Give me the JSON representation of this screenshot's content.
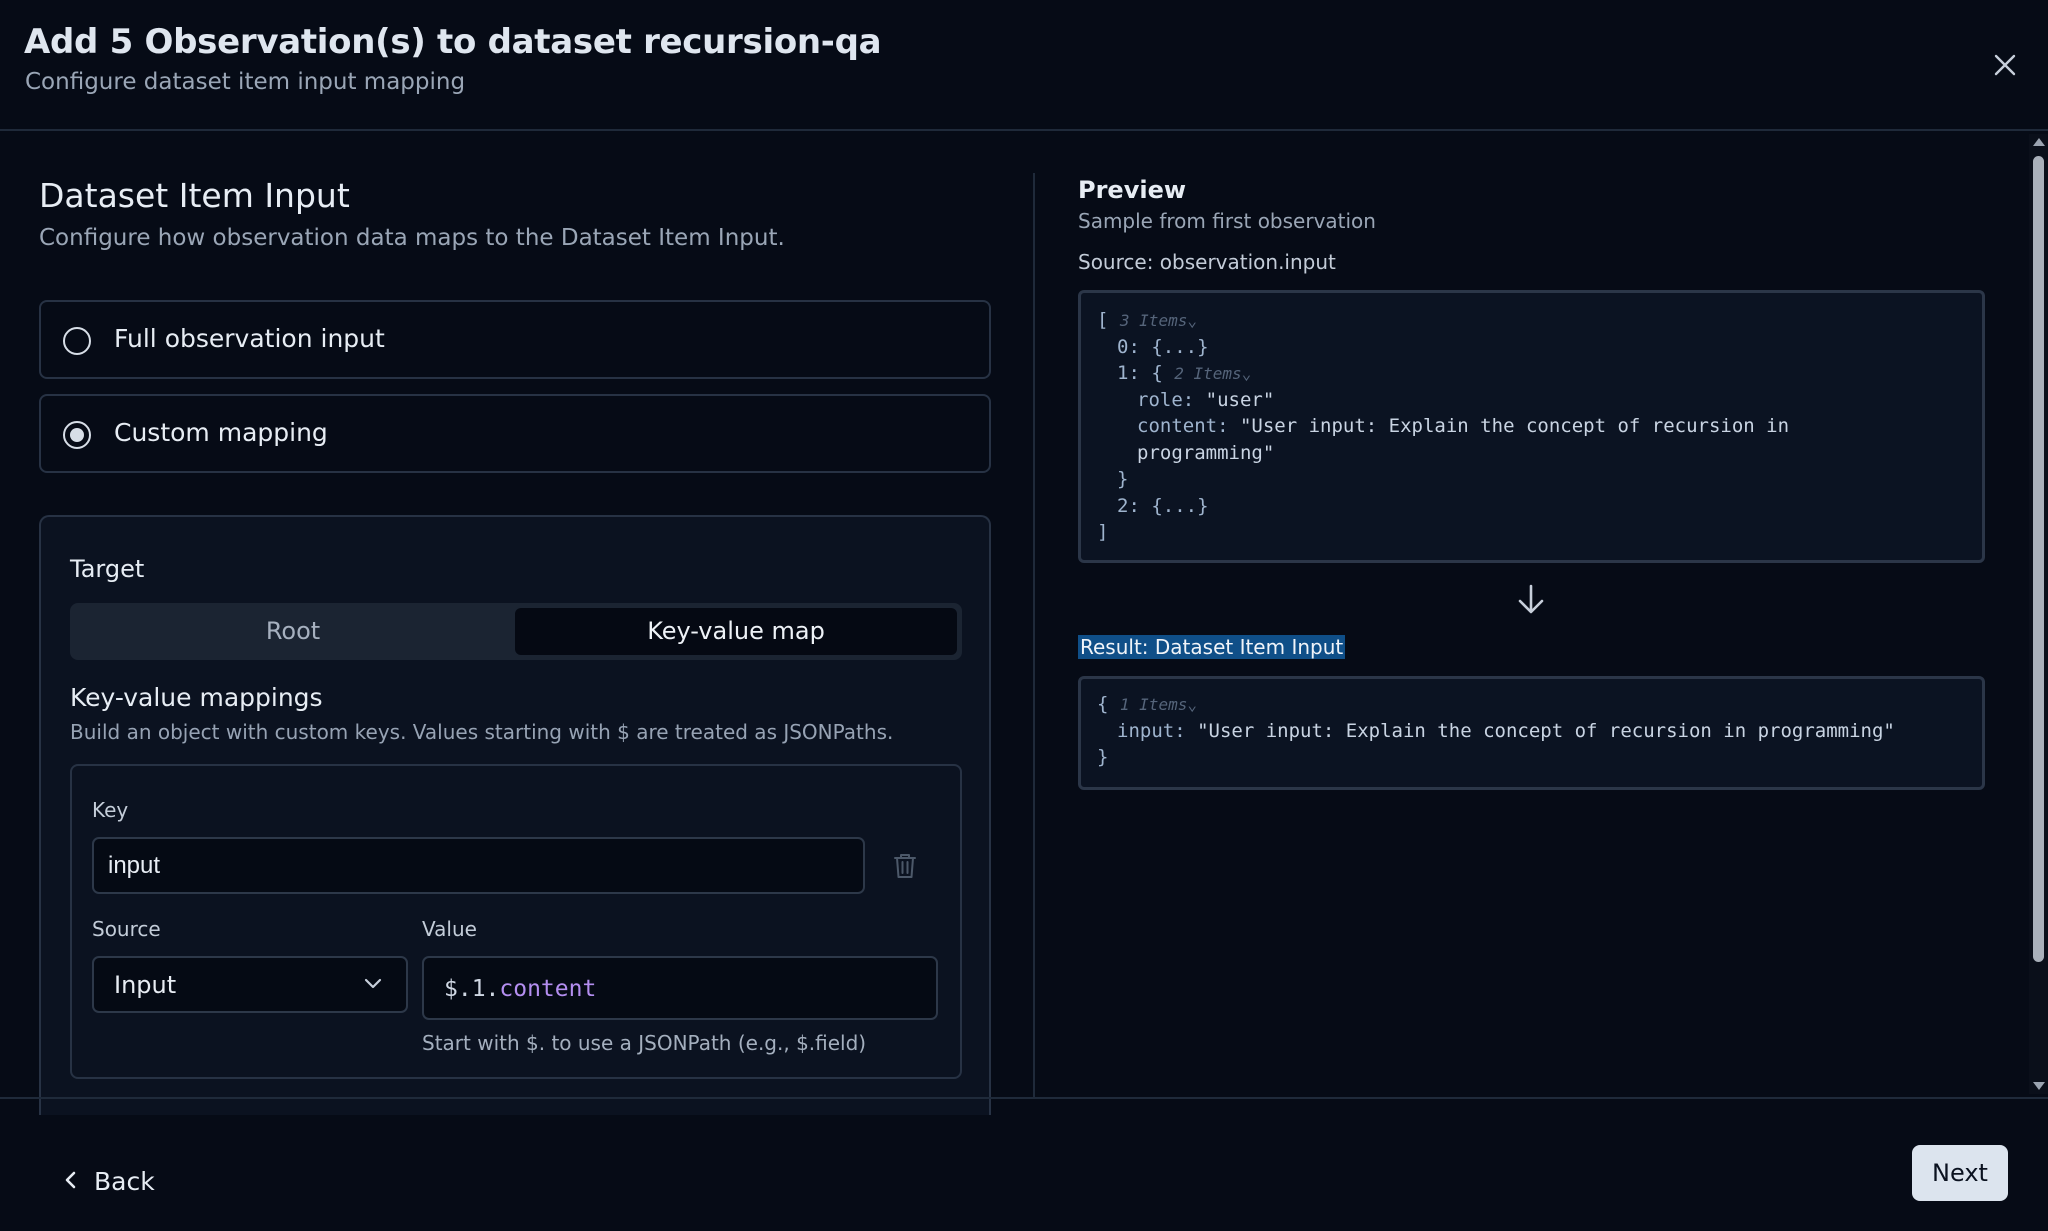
{
  "dialog": {
    "title": "Add 5 Observation(s) to dataset recursion-qa",
    "subtitle": "Configure dataset item input mapping"
  },
  "left": {
    "section_title": "Dataset Item Input",
    "section_desc": "Configure how observation data maps to the Dataset Item Input.",
    "options": [
      {
        "label": "Full observation input",
        "checked": false
      },
      {
        "label": "Custom mapping",
        "checked": true
      }
    ],
    "target": {
      "label": "Target",
      "segments": [
        "Root",
        "Key-value map"
      ],
      "selected": "Key-value map"
    },
    "kv": {
      "title": "Key-value mappings",
      "desc": "Build an object with custom keys. Values starting with $ are treated as JSONPaths.",
      "key_label": "Key",
      "key_value": "input",
      "source_label": "Source",
      "source_value": "Input",
      "value_label": "Value",
      "value_parts": [
        "$.1.",
        "content"
      ],
      "hint": "Start with $. to use a JSONPath (e.g., $.field)"
    }
  },
  "preview": {
    "title": "Preview",
    "sub": "Sample from first observation",
    "source": "Source: observation.input",
    "source_json": {
      "open": "[",
      "meta_root": "3 Items",
      "item0": "0: {...}",
      "item1_open": "1: {",
      "meta_item1": "2 Items",
      "role_key": "role:",
      "role_val": "\"user\"",
      "content_key": "content:",
      "content_val_1": "\"User input: Explain the concept of recursion in",
      "content_val_2": "programming\"",
      "item1_close": "}",
      "item2": "2: {...}",
      "close": "]"
    },
    "result_label": "Result: Dataset Item Input",
    "result_json": {
      "open": "{",
      "meta": "1 Items",
      "key": "input:",
      "val": "\"User input: Explain the concept of recursion in programming\"",
      "close": "}"
    }
  },
  "footer": {
    "back": "Back",
    "next": "Next"
  }
}
